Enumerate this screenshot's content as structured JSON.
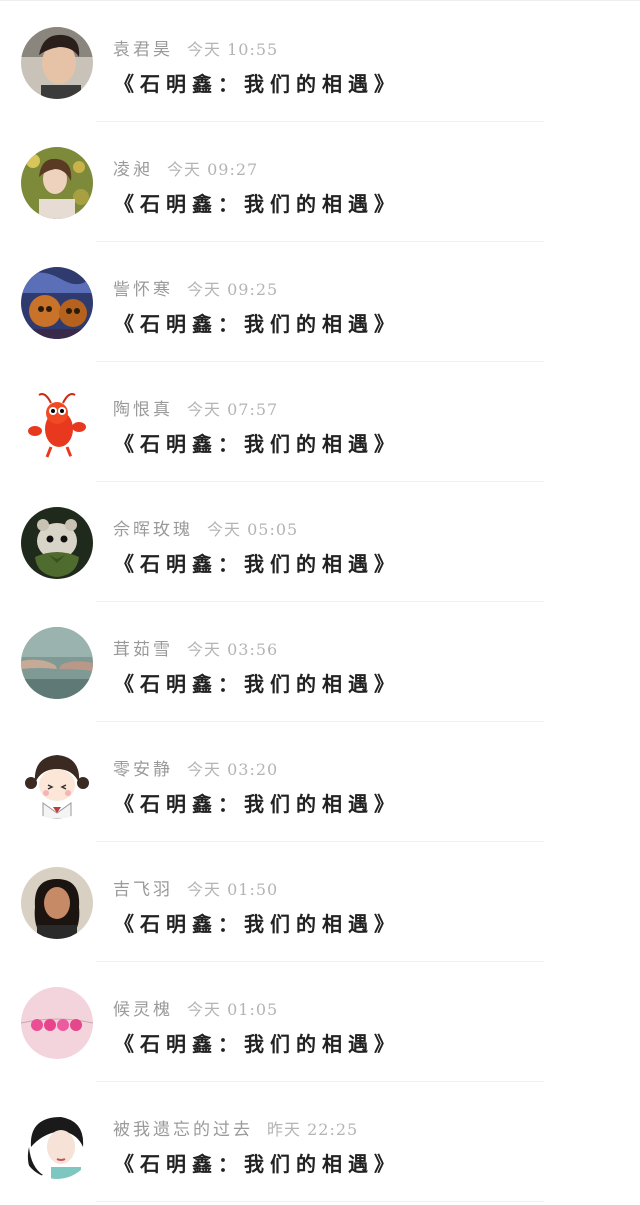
{
  "comments": [
    {
      "user": "袁君昊",
      "time": "今天 10:55",
      "text": "《石明鑫：我们的相遇》",
      "avatar": "man-portrait-avatar"
    },
    {
      "user": "凌昶",
      "time": "今天 09:27",
      "text": "《石明鑫：我们的相遇》",
      "avatar": "girl-flowers-avatar"
    },
    {
      "user": "訾怀寒",
      "time": "今天 09:25",
      "text": "《石明鑫：我们的相遇》",
      "avatar": "painted-art-avatar"
    },
    {
      "user": "陶恨真",
      "time": "今天 07:57",
      "text": "《石明鑫：我们的相遇》",
      "avatar": "lobster-cartoon-avatar"
    },
    {
      "user": "佘晖玫瑰",
      "time": "今天 05:05",
      "text": "《石明鑫：我们的相遇》",
      "avatar": "hamster-avatar"
    },
    {
      "user": "茸茹雪",
      "time": "今天 03:56",
      "text": "《石明鑫：我们的相遇》",
      "avatar": "hands-rain-avatar"
    },
    {
      "user": "零安静",
      "time": "今天 03:20",
      "text": "《石明鑫：我们的相遇》",
      "avatar": "cartoon-girl-avatar"
    },
    {
      "user": "吉飞羽",
      "time": "今天 01:50",
      "text": "《石明鑫：我们的相遇》",
      "avatar": "woman-photo-avatar"
    },
    {
      "user": "候灵槐",
      "time": "今天 01:05",
      "text": "《石明鑫：我们的相遇》",
      "avatar": "pink-hearts-avatar"
    },
    {
      "user": "被我遗忘的过去",
      "time": "昨天 22:25",
      "text": "《石明鑫：我们的相遇》",
      "avatar": "woman-drawing-avatar"
    }
  ]
}
